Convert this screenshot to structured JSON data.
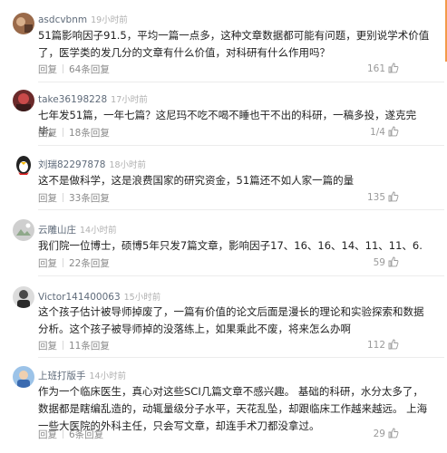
{
  "comments": [
    {
      "username": "asdcvbnm",
      "time": "19小时前",
      "text": "51篇影响因子91.5，平均一篇一点多，这种文章数据都可能有问题，更别说学术价值了，医学类的发几分的文章有什么价值，对科研有什么作用吗？",
      "reply_label": "回复",
      "replies_label": "64条回复",
      "likes": "161",
      "avatar_color": "#9a6a4a"
    },
    {
      "username": "take36198228",
      "time": "17小时前",
      "text": "七年发51篇，一年七篇？这尼玛不吃不喝不睡也干不出的科研，一稿多投，遂克完毕。",
      "reply_label": "回复",
      "replies_label": "18条回复",
      "likes": "1/4",
      "avatar_color": "#6b2a2a"
    },
    {
      "username": "刘瑞82297878",
      "time": "18小时前",
      "text": "这不是做科学，这是浪费国家的研究资金，51篇还不如人家一篇的量",
      "reply_label": "回复",
      "replies_label": "33条回复",
      "likes": "135",
      "avatar_color": "#e02020"
    },
    {
      "username": "云雕山庄",
      "time": "14小时前",
      "text": "我们院一位博士，硕博5年只发7篇文章，影响因子17、16、16、14、11、11、6.",
      "reply_label": "回复",
      "replies_label": "22条回复",
      "likes": "59",
      "avatar_color": "#cfcfcf"
    },
    {
      "username": "Victor141400063",
      "time": "15小时前",
      "text": "这个孩子估计被导师掉废了，一篇有价值的论文后面是漫长的理论和实验探索和数据分析。这个孩子被导师掉的没落练上，如果乘此不废，将来怎么办啊",
      "reply_label": "回复",
      "replies_label": "11条回复",
      "likes": "112",
      "avatar_color": "#4a4a4a"
    },
    {
      "username": "上班打版手",
      "time": "14小时前",
      "text": "作为一个临床医生，真心对这些SCI几篇文章不感兴趣。 基础的科研，水分太多了，数据都是瞎编乱造的，动辄量级分子水平，天花乱坠，却跟临床工作越来越远。 上海一些大医院的外科主任，只会写文章，却连手术刀都没拿过。",
      "reply_label": "回复",
      "replies_label": "6条回复",
      "likes": "29",
      "avatar_color": "#3a6ab0"
    }
  ]
}
